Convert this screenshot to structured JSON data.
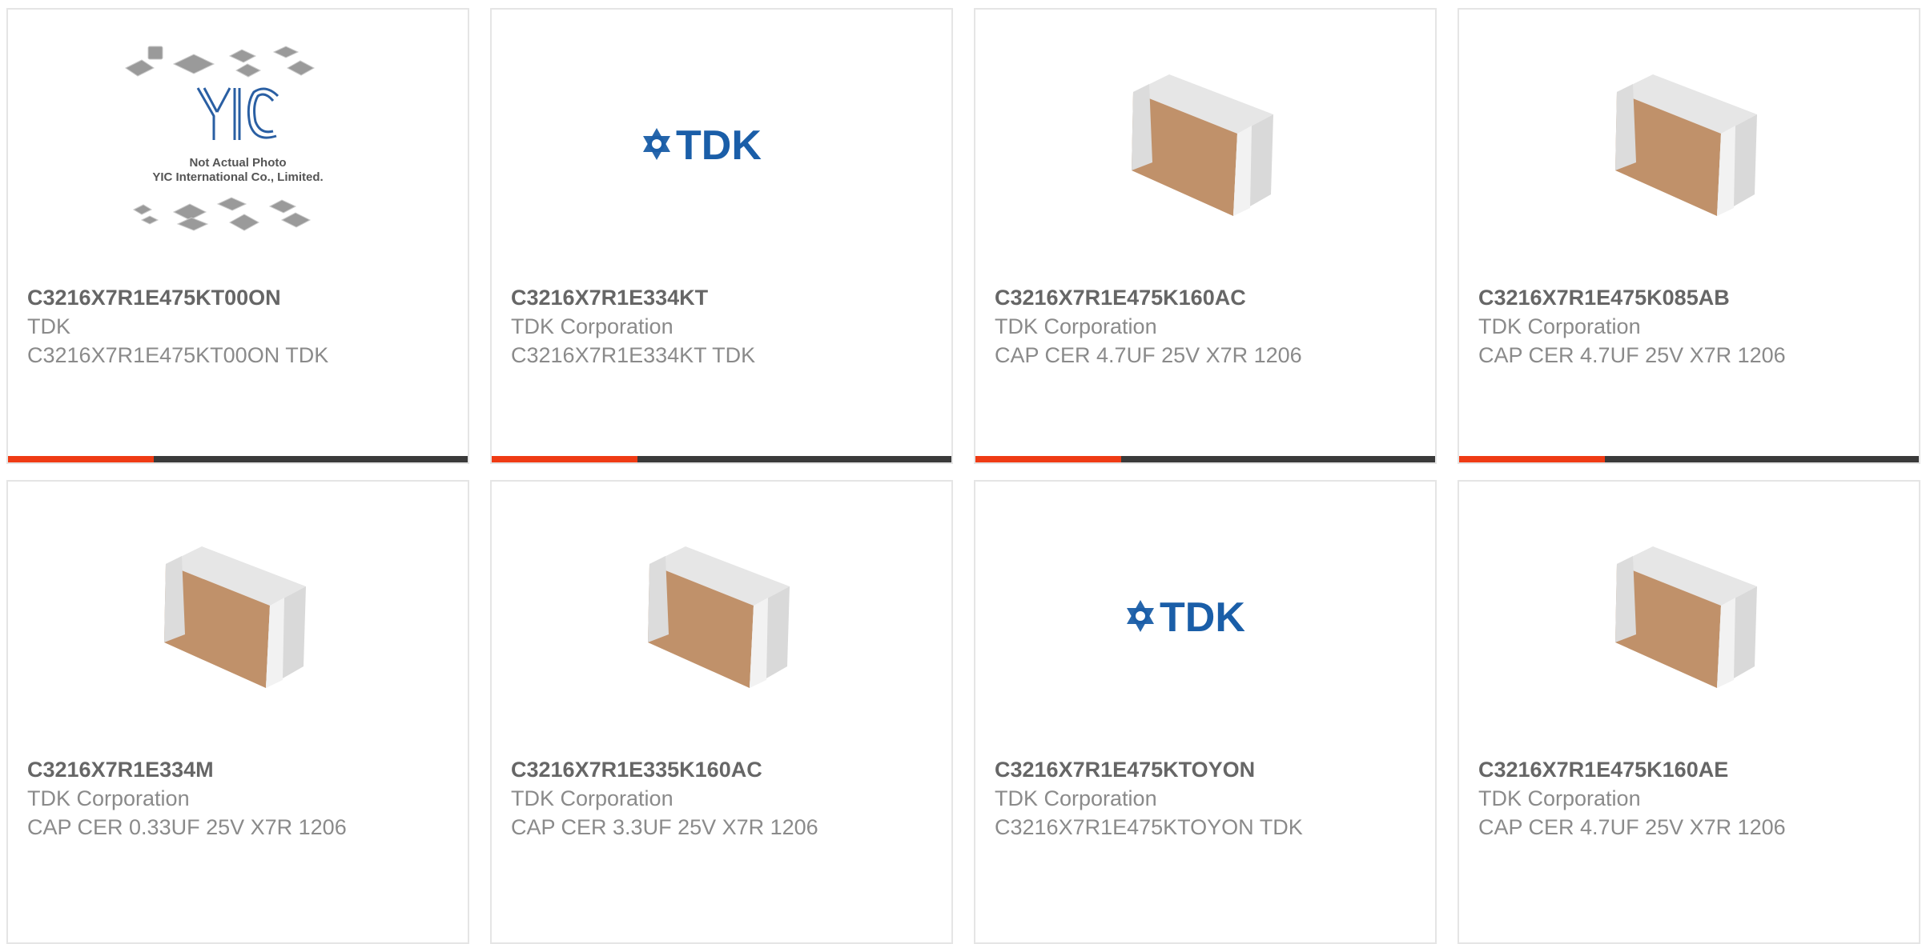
{
  "products": [
    {
      "part_number": "C3216X7R1E475KT00ON",
      "manufacturer": "TDK",
      "description": "C3216X7R1E475KT00ON TDK",
      "image": "yic-not-actual-photo",
      "photo_note_line1": "Not Actual Photo",
      "photo_note_line2": "YIC International Co., Limited.",
      "logo_text": "YIC"
    },
    {
      "part_number": "C3216X7R1E334KT",
      "manufacturer": "TDK Corporation",
      "description": "C3216X7R1E334KT TDK",
      "image": "tdk-logo",
      "logo_text": "TDK"
    },
    {
      "part_number": "C3216X7R1E475K160AC",
      "manufacturer": "TDK Corporation",
      "description": "CAP CER 4.7UF 25V X7R 1206",
      "image": "mlcc-capacitor"
    },
    {
      "part_number": "C3216X7R1E475K085AB",
      "manufacturer": "TDK Corporation",
      "description": "CAP CER 4.7UF 25V X7R 1206",
      "image": "mlcc-capacitor"
    },
    {
      "part_number": "C3216X7R1E334M",
      "manufacturer": "TDK Corporation",
      "description": "CAP CER 0.33UF 25V X7R 1206",
      "image": "mlcc-capacitor"
    },
    {
      "part_number": "C3216X7R1E335K160AC",
      "manufacturer": "TDK Corporation",
      "description": "CAP CER 3.3UF 25V X7R 1206",
      "image": "mlcc-capacitor"
    },
    {
      "part_number": "C3216X7R1E475KTOYON",
      "manufacturer": "TDK Corporation",
      "description": "C3216X7R1E475KTOYON TDK",
      "image": "tdk-logo",
      "logo_text": "TDK"
    },
    {
      "part_number": "C3216X7R1E475K160AE",
      "manufacturer": "TDK Corporation",
      "description": "CAP CER 4.7UF 25V X7R 1206",
      "image": "mlcc-capacitor"
    }
  ],
  "colors": {
    "accent": "#ef3b14",
    "bar_dark": "#3a3a3a",
    "tdk_blue": "#1a5ea8",
    "capacitor_body": "#c0916a"
  }
}
